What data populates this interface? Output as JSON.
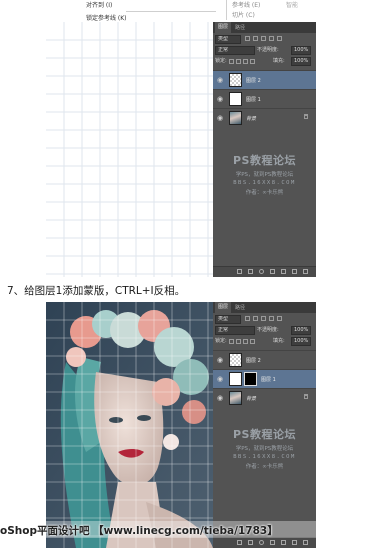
{
  "top_menu": {
    "left_item_1": "对齐到 (I)",
    "left_item_2": "锁定参考线 (K)",
    "right_item_1": "参考线 (E)",
    "right_item_2": "切片 (C)",
    "right_item_3": "智能"
  },
  "caption": "7、给图层1添加蒙版，CTRL+I反相。",
  "panels": {
    "tab_layers": "图层",
    "tab_paths": "路径",
    "filter_kind": "类型",
    "blend_mode": "正常",
    "opacity_label": "不透明度:",
    "opacity_value": "100%",
    "lock_label": "锁定:",
    "fill_label": "填充:",
    "fill_value": "100%"
  },
  "screenshot1": {
    "layers": [
      {
        "name": "图层 2",
        "thumb": "transparent",
        "selected": true,
        "locked": false
      },
      {
        "name": "图层 1",
        "thumb": "white",
        "selected": false,
        "locked": false
      },
      {
        "name": "背景",
        "thumb": "photo",
        "selected": false,
        "locked": true
      }
    ]
  },
  "screenshot2": {
    "layers": [
      {
        "name": "图层 2",
        "thumb": "transparent",
        "selected": false,
        "locked": false
      },
      {
        "name": "图层 1",
        "thumb": "white",
        "mask": true,
        "selected": true,
        "locked": false
      },
      {
        "name": "背景",
        "thumb": "photo",
        "selected": false,
        "locked": true
      }
    ]
  },
  "watermark": {
    "title": "PS教程论坛",
    "subtitle": "学PS，就到PS教程论坛",
    "site": "BBS.16XX8.COM",
    "author": "作者：∞卡乐熊"
  },
  "site_banner": "oShop平面设计吧 【www.linecg.com/tieba/1783】",
  "colors": {
    "panel_bg": "#535353",
    "selected_layer": "#5d7593",
    "canvas_photo_bg": "#3b4b5b"
  },
  "icons": [
    "eye-icon",
    "lock-icon",
    "new-layer-icon",
    "trash-icon",
    "mask-icon",
    "fx-icon"
  ]
}
